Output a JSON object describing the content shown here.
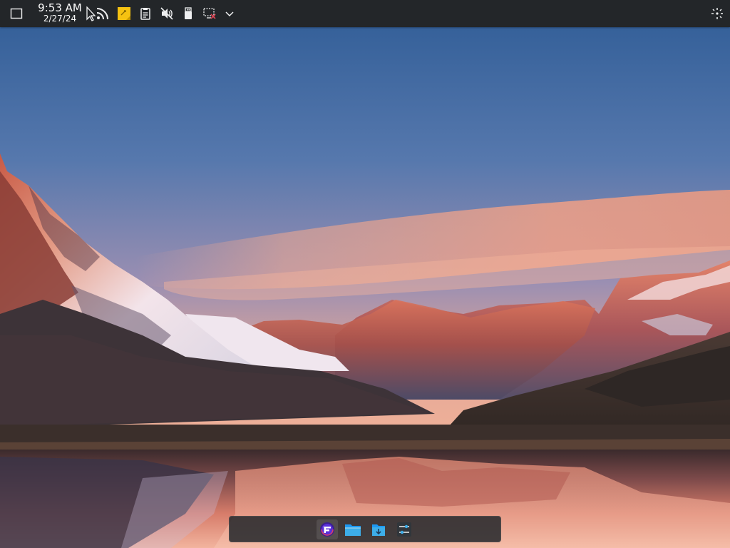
{
  "clock": {
    "time": "9:53 AM",
    "date": "2/27/24"
  },
  "tray_icons": [
    "network-feed-icon",
    "sticky-notes-icon",
    "clipboard-icon",
    "volume-muted-icon",
    "usb-device-icon",
    "display-disconnected-icon",
    "expand-tray-chevron-icon"
  ],
  "dock_items": [
    "firefox-icon",
    "files-folder-icon",
    "downloads-folder-icon",
    "settings-icon"
  ],
  "colors": {
    "panel_bg": "#232629",
    "panel_text": "#fcfcfc",
    "dock_bg": "#2a2c30",
    "accent_blue": "#3daee9",
    "sticky_yellow": "#f5c211"
  }
}
